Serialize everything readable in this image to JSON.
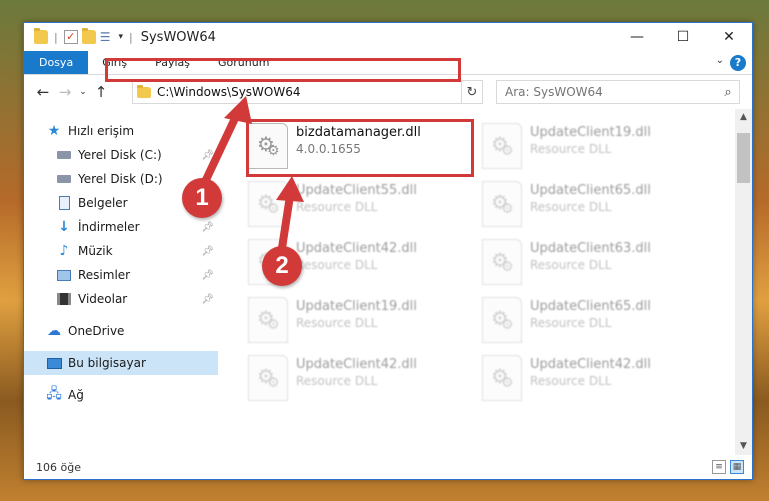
{
  "window": {
    "title": "SysWOW64"
  },
  "ribbon": {
    "tabs": [
      {
        "label": "Dosya"
      },
      {
        "label": "Giriş"
      },
      {
        "label": "Paylaş"
      },
      {
        "label": "Görünüm"
      }
    ]
  },
  "nav": {
    "address_path": "C:\\Windows\\SysWOW64",
    "search_placeholder": "Ara: SysWOW64"
  },
  "sidebar": {
    "items": [
      {
        "label": "Hızlı erişim",
        "icon": "star-icon"
      },
      {
        "label": "Yerel Disk (C:)",
        "icon": "drive-icon",
        "pinned": true
      },
      {
        "label": "Yerel Disk (D:)",
        "icon": "drive-icon",
        "pinned": false
      },
      {
        "label": "Belgeler",
        "icon": "documents-icon",
        "pinned": true
      },
      {
        "label": "İndirmeler",
        "icon": "download-icon",
        "pinned": true
      },
      {
        "label": "Müzik",
        "icon": "music-icon",
        "pinned": true
      },
      {
        "label": "Resimler",
        "icon": "pictures-icon",
        "pinned": true
      },
      {
        "label": "Videolar",
        "icon": "videos-icon",
        "pinned": true
      },
      {
        "label": "OneDrive",
        "icon": "cloud-icon"
      },
      {
        "label": "Bu bilgisayar",
        "icon": "computer-icon",
        "selected": true
      },
      {
        "label": "Ağ",
        "icon": "network-icon"
      }
    ]
  },
  "files": [
    {
      "name": "bizdatamanager.dll",
      "sub": "4.0.0.1655"
    },
    {
      "name": "UpdateClient19.dll",
      "sub": "Resource DLL"
    },
    {
      "name": "UpdateClient55.dll",
      "sub": "Resource DLL"
    },
    {
      "name": "UpdateClient65.dll",
      "sub": "Resource DLL"
    },
    {
      "name": "UpdateClient42.dll",
      "sub": "Resource DLL"
    },
    {
      "name": "UpdateClient63.dll",
      "sub": "Resource DLL"
    },
    {
      "name": "UpdateClient19.dll",
      "sub": "Resource DLL"
    },
    {
      "name": "UpdateClient65.dll",
      "sub": "Resource DLL"
    },
    {
      "name": "UpdateClient42.dll",
      "sub": "Resource DLL"
    },
    {
      "name": "UpdateClient42.dll",
      "sub": "Resource DLL"
    }
  ],
  "status": {
    "count": "106 öğe"
  },
  "callouts": {
    "one": "1",
    "two": "2"
  },
  "colors": {
    "accent": "#1979ca",
    "highlight": "#d23a3a",
    "selected": "#cce4f7"
  }
}
